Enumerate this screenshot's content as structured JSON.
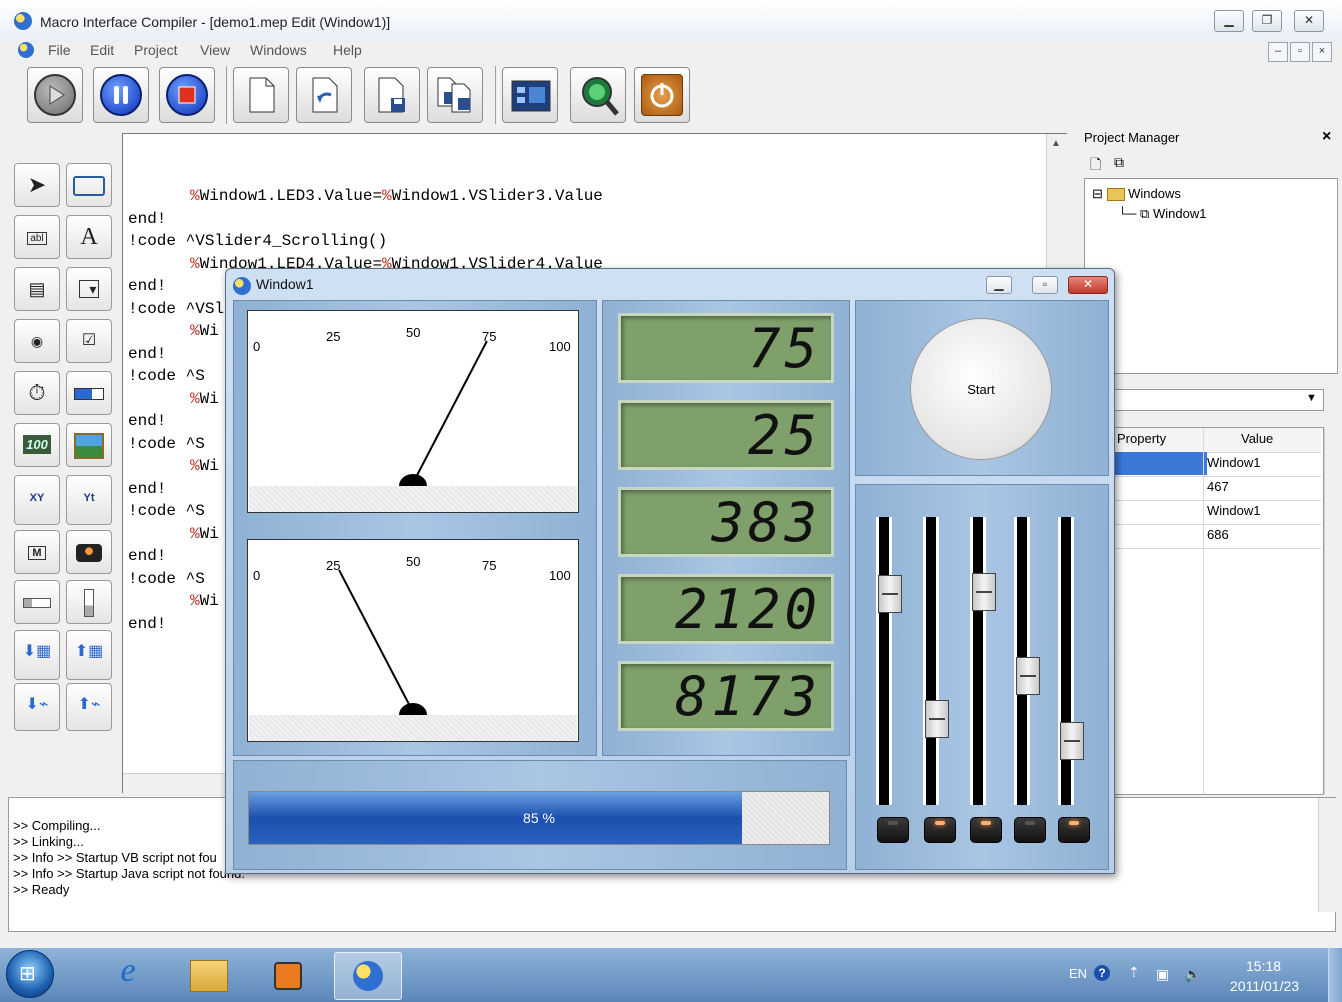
{
  "window": {
    "title": "Macro Interface Compiler - [demo1.mep Edit (Window1)]"
  },
  "menu": {
    "items": [
      "File",
      "Edit",
      "Project",
      "View",
      "Windows",
      "Help"
    ]
  },
  "toolbar": {
    "icons": [
      "run-icon",
      "pause-icon",
      "stop-icon",
      "new-file-icon",
      "undo-icon",
      "open-file-icon",
      "save-file-icon",
      "run-window-icon",
      "compile-icon",
      "exit-icon"
    ]
  },
  "palette": {
    "icons": [
      "pointer-icon",
      "rectangle-icon",
      "textbox-icon",
      "label-icon",
      "listbox-icon",
      "combobox-icon",
      "radio-icon",
      "checkbox-icon",
      "timer-icon",
      "progressbar-icon",
      "lcd-icon",
      "image-icon",
      "xy-chart-icon",
      "yt-chart-icon",
      "meter-icon",
      "led-icon",
      "hslider-icon",
      "vslider-icon",
      "download-board-icon",
      "upload-board-icon",
      "download-usb-icon",
      "upload-usb-icon"
    ],
    "label_text": "A",
    "lcd_text": "100"
  },
  "editor": {
    "lines": [
      {
        "indent": true,
        "text": "%Window1.LED3.Value=%Window1.VSlider3.Value"
      },
      {
        "indent": false,
        "text": "end!"
      },
      {
        "indent": false,
        "text": "!code ^VSlider4_Scrolling()"
      },
      {
        "indent": true,
        "text": "%Window1.LED4.Value=%Window1.VSlider4.Value"
      },
      {
        "indent": false,
        "text": "end!"
      },
      {
        "indent": false,
        "text": "!code ^VSlider5_Scrolling()"
      },
      {
        "indent": true,
        "text": "%Wi"
      },
      {
        "indent": false,
        "text": "end!"
      },
      {
        "indent": false,
        "text": "!code ^S"
      },
      {
        "indent": true,
        "text": "%Wi"
      },
      {
        "indent": false,
        "text": "end!"
      },
      {
        "indent": false,
        "text": "!code ^S"
      },
      {
        "indent": true,
        "text": "%Wi"
      },
      {
        "indent": false,
        "text": "end!"
      },
      {
        "indent": false,
        "text": "!code ^S"
      },
      {
        "indent": true,
        "text": "%Wi"
      },
      {
        "indent": false,
        "text": "end!"
      },
      {
        "indent": false,
        "text": "!code ^S"
      },
      {
        "indent": true,
        "text": "%Wi"
      },
      {
        "indent": false,
        "text": "end!"
      }
    ]
  },
  "project_manager": {
    "title": "Project Manager",
    "tree": {
      "root": "Windows",
      "child": "Window1"
    },
    "columns": [
      "Property",
      "Value"
    ],
    "rows": [
      {
        "property": "ne",
        "value": "Window1"
      },
      {
        "property": "ght",
        "value": "467"
      },
      {
        "property": "t",
        "value": "Window1"
      },
      {
        "property": "th",
        "value": "686"
      }
    ]
  },
  "output": {
    "lines": [
      ">> Compiling...",
      ">> Linking...",
      ">> Info >> Startup VB script not fou",
      ">> Info >> Startup Java script not found.",
      ">> Ready"
    ]
  },
  "window1": {
    "title": "Window1",
    "meters": [
      {
        "ticks": [
          "0",
          "25",
          "50",
          "75",
          "100"
        ],
        "value": 75
      },
      {
        "ticks": [
          "0",
          "25",
          "50",
          "75",
          "100"
        ],
        "value": 25
      }
    ],
    "lcds": [
      "75",
      "25",
      "383",
      "2120",
      "8173"
    ],
    "start_button": "Start",
    "progress": {
      "value": 85,
      "label": "85 %"
    },
    "sliders": [
      60,
      25,
      70,
      45,
      20
    ],
    "leds": [
      false,
      true,
      true,
      false,
      true
    ]
  },
  "taskbar": {
    "lang": "EN",
    "time": "15:18",
    "date": "2011/01/23"
  }
}
